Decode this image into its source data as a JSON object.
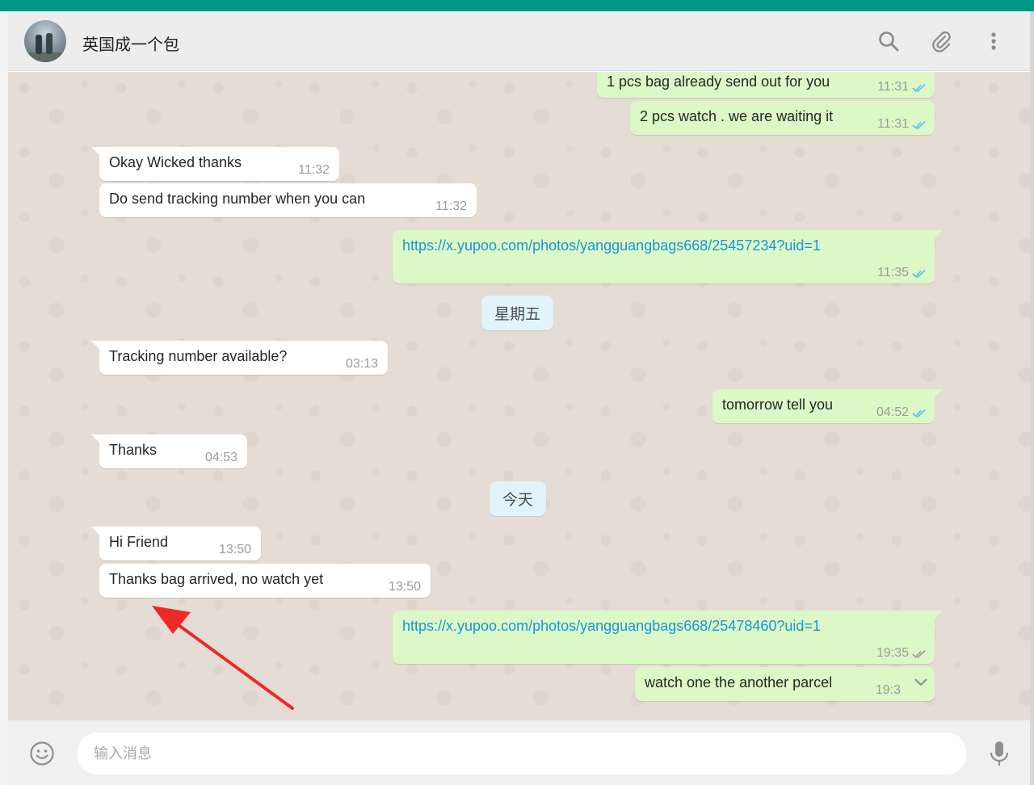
{
  "header": {
    "chat_name": "英国成一个包",
    "icons": [
      "search-icon",
      "attach-icon",
      "menu-icon"
    ]
  },
  "messages": [
    {
      "dir": "out",
      "text": "1 pcs bag already send out for you",
      "time": "11:31",
      "status": "read"
    },
    {
      "dir": "out",
      "text": "2 pcs watch . we are waiting it",
      "time": "11:31",
      "status": "read"
    },
    {
      "dir": "in",
      "text": "Okay Wicked thanks",
      "time": "11:32"
    },
    {
      "dir": "in",
      "text": "Do send tracking number when you can",
      "time": "11:32"
    },
    {
      "dir": "out",
      "text": "https://x.yupoo.com/photos/yangguangbags668/25457234?uid=1",
      "time": "11:35",
      "status": "read",
      "link": true
    },
    {
      "dir": "in",
      "text": "Tracking number available?",
      "time": "03:13"
    },
    {
      "dir": "out",
      "text": "tomorrow tell you",
      "time": "04:52",
      "status": "read"
    },
    {
      "dir": "in",
      "text": "Thanks",
      "time": "04:53"
    },
    {
      "dir": "in",
      "text": "Hi Friend",
      "time": "13:50"
    },
    {
      "dir": "in",
      "text": "Thanks  bag arrived, no watch yet",
      "time": "13:50"
    },
    {
      "dir": "out",
      "text": "https://x.yupoo.com/photos/yangguangbags668/25478460?uid=1",
      "time": "19:35",
      "status": "sent",
      "link": true
    },
    {
      "dir": "out",
      "text": "watch one the another parcel",
      "time": "19:3",
      "status": "menu"
    }
  ],
  "day_separators": [
    "星期五",
    "今天"
  ],
  "composer": {
    "placeholder": "输入消息"
  },
  "colors": {
    "accent": "#009688",
    "incoming_bubble": "#ffffff",
    "outgoing_bubble": "#dcf8c6",
    "chat_bg": "#e5ddd5",
    "link": "#1a95d6",
    "read_ticks": "#4fc3f7",
    "annotation_arrow": "#ee2a24"
  }
}
